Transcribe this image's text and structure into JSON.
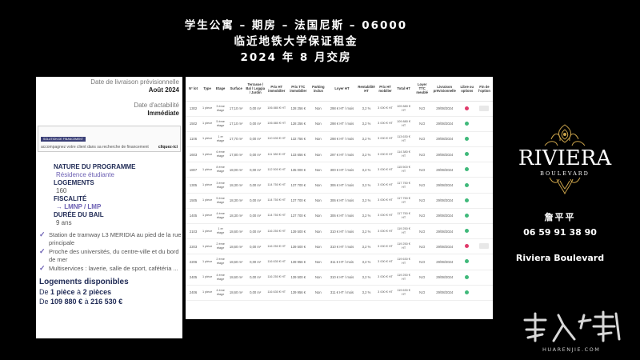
{
  "title": {
    "line1": "学生公寓 – 期房 – 法国尼斯 – 06000",
    "line2": "临近地铁大学保证租金",
    "line3": "2024 年 8 月交房"
  },
  "panel": {
    "delivery_label": "Date de livraison prévisionnelle",
    "delivery_value": "Août 2024",
    "actability_label": "Date d'actabilité",
    "actability_value": "Immédiate",
    "financing_tag": "SOLUTION DE FINANCEMENT",
    "financing_text": "accompagnez votre client dans sa recherche de financement",
    "financing_link": "cliquez-ici",
    "program_heading": "NATURE DU PROGRAMME",
    "program_value": "Résidence étudiante",
    "logements_heading": "LOGEMENTS",
    "logements_value": "160",
    "fiscalite_heading": "FISCALITÉ",
    "fiscalite_value": "→ LMNP / LMP",
    "bail_heading": "DURÉE DU BAIL",
    "bail_value": "9 ans",
    "checks": [
      "Station de tramway L3 MERIDIA au pied de la rue principale",
      "Proche des universités, du centre-ville et du bord de mer",
      "Multiservices : laverie, salle de sport, cafétéria ..."
    ],
    "avail_heading": "Logements disponibles",
    "avail_rooms_pre": "De ",
    "avail_rooms_from": "1 pièce",
    "avail_rooms_mid": " à ",
    "avail_rooms_to": "2 pièces",
    "avail_price_pre": "De ",
    "avail_price_from": "109 880 €",
    "avail_price_mid": " à ",
    "avail_price_to": "216 530 €"
  },
  "table": {
    "headers": [
      "N° lot",
      "Type",
      "Etage",
      "Surface",
      "Terrasse / Bal / Loggia / Jardin",
      "Prix HT immobilier",
      "Prix TTC immobilier",
      "Parking inclus",
      "Loyer HT",
      "Rentabilité HT",
      "Prix HT mobilier",
      "Total HT",
      "Loyer TTC meublé",
      "Livraison prévisionnelle",
      "Libre ou options",
      "Fin de l'option"
    ],
    "rows": [
      {
        "lot": "1302",
        "type": "1 pièce",
        "etage": "3 ème étage",
        "surface": "17,10 m²",
        "terrasse": "0,00 m²",
        "prix_ht": "106 880 € HT",
        "prix_ttc": "128 256 €",
        "parking": "Non",
        "loyer": "298 € HT / mois",
        "renta": "3,2 %",
        "mobilier": "3 000 € HT",
        "total": "109 880 € HT",
        "loyer_ttc": "N.D",
        "livraison": "29/08/2024",
        "status": "r",
        "fin": "thumb"
      },
      {
        "lot": "1502",
        "type": "1 pièce",
        "etage": "5 ème étage",
        "surface": "17,10 m²",
        "terrasse": "0,00 m²",
        "prix_ht": "106 880 € HT",
        "prix_ttc": "128 256 €",
        "parking": "Non",
        "loyer": "298 € HT / mois",
        "renta": "3,2 %",
        "mobilier": "3 000 € HT",
        "total": "109 880 € HT",
        "loyer_ttc": "N.D",
        "livraison": "29/08/2024",
        "status": "g",
        "fin": ""
      },
      {
        "lot": "1106",
        "type": "1 pièce",
        "etage": "1 er étage",
        "surface": "17,70 m²",
        "terrasse": "0,00 m²",
        "prix_ht": "110 630 € HT",
        "prix_ttc": "132 756 €",
        "parking": "Non",
        "loyer": "298 € HT / mois",
        "renta": "3,2 %",
        "mobilier": "3 000 € HT",
        "total": "113 630 € HT",
        "loyer_ttc": "N.D",
        "livraison": "29/08/2024",
        "status": "g",
        "fin": ""
      },
      {
        "lot": "1603",
        "type": "1 pièce",
        "etage": "6 ème étage",
        "surface": "17,80 m²",
        "terrasse": "0,00 m²",
        "prix_ht": "111 380 € HT",
        "prix_ttc": "133 656 €",
        "parking": "Non",
        "loyer": "297 € HT / mois",
        "renta": "3,2 %",
        "mobilier": "3 000 € HT",
        "total": "114 380 € HT",
        "loyer_ttc": "N.D",
        "livraison": "29/08/2024",
        "status": "g",
        "fin": ""
      },
      {
        "lot": "1807",
        "type": "1 pièce",
        "etage": "8 ème étage",
        "surface": "18,00 m²",
        "terrasse": "0,00 m²",
        "prix_ht": "112 500 € HT",
        "prix_ttc": "135 000 €",
        "parking": "Non",
        "loyer": "300 € HT / mois",
        "renta": "3,2 %",
        "mobilier": "3 000 € HT",
        "total": "115 500 € HT",
        "loyer_ttc": "N.D",
        "livraison": "29/08/2024",
        "status": "g",
        "fin": ""
      },
      {
        "lot": "1305",
        "type": "1 pièce",
        "etage": "3 ème étage",
        "surface": "18,30 m²",
        "terrasse": "0,00 m²",
        "prix_ht": "114 750 € HT",
        "prix_ttc": "137 700 €",
        "parking": "Non",
        "loyer": "306 € HT / mois",
        "renta": "3,2 %",
        "mobilier": "3 000 € HT",
        "total": "117 750 € HT",
        "loyer_ttc": "N.D",
        "livraison": "29/08/2024",
        "status": "g",
        "fin": ""
      },
      {
        "lot": "1505",
        "type": "1 pièce",
        "etage": "5 ème étage",
        "surface": "18,30 m²",
        "terrasse": "0,00 m²",
        "prix_ht": "114 750 € HT",
        "prix_ttc": "137 700 €",
        "parking": "Non",
        "loyer": "306 € HT / mois",
        "renta": "3,2 %",
        "mobilier": "3 000 € HT",
        "total": "117 750 € HT",
        "loyer_ttc": "N.D",
        "livraison": "29/08/2024",
        "status": "g",
        "fin": ""
      },
      {
        "lot": "1405",
        "type": "1 pièce",
        "etage": "4 ème étage",
        "surface": "18,30 m²",
        "terrasse": "0,00 m²",
        "prix_ht": "114 750 € HT",
        "prix_ttc": "137 700 €",
        "parking": "Non",
        "loyer": "306 € HT / mois",
        "renta": "3,2 %",
        "mobilier": "3 000 € HT",
        "total": "117 750 € HT",
        "loyer_ttc": "N.D",
        "livraison": "29/08/2024",
        "status": "g",
        "fin": ""
      },
      {
        "lot": "2103",
        "type": "1 pièce",
        "etage": "1 er étage",
        "surface": "18,60 m²",
        "terrasse": "0,00 m²",
        "prix_ht": "116 250 € HT",
        "prix_ttc": "139 500 €",
        "parking": "Non",
        "loyer": "310 € HT / mois",
        "renta": "3,2 %",
        "mobilier": "3 000 € HT",
        "total": "119 250 € HT",
        "loyer_ttc": "N.D",
        "livraison": "29/08/2024",
        "status": "g",
        "fin": ""
      },
      {
        "lot": "2203",
        "type": "1 pièce",
        "etage": "2 ème étage",
        "surface": "18,60 m²",
        "terrasse": "0,00 m²",
        "prix_ht": "116 250 € HT",
        "prix_ttc": "139 500 €",
        "parking": "Non",
        "loyer": "310 € HT / mois",
        "renta": "3,2 %",
        "mobilier": "3 000 € HT",
        "total": "119 250 € HT",
        "loyer_ttc": "N.D",
        "livraison": "29/08/2024",
        "status": "r",
        "fin": "thumb"
      },
      {
        "lot": "2206",
        "type": "1 pièce",
        "etage": "2 ème étage",
        "surface": "18,60 m²",
        "terrasse": "0,00 m²",
        "prix_ht": "116 630 € HT",
        "prix_ttc": "139 956 €",
        "parking": "Non",
        "loyer": "311 € HT / mois",
        "renta": "3,2 %",
        "mobilier": "3 000 € HT",
        "total": "119 630 € HT",
        "loyer_ttc": "N.D",
        "livraison": "29/08/2024",
        "status": "g",
        "fin": ""
      },
      {
        "lot": "2405",
        "type": "1 pièce",
        "etage": "4 ème étage",
        "surface": "18,60 m²",
        "terrasse": "0,00 m²",
        "prix_ht": "116 250 € HT",
        "prix_ttc": "139 500 €",
        "parking": "Non",
        "loyer": "310 € HT / mois",
        "renta": "3,2 %",
        "mobilier": "3 000 € HT",
        "total": "119 250 € HT",
        "loyer_ttc": "N.D",
        "livraison": "29/08/2024",
        "status": "g",
        "fin": ""
      },
      {
        "lot": "2406",
        "type": "1 pièce",
        "etage": "4 ème étage",
        "surface": "18,60 m²",
        "terrasse": "0,00 m²",
        "prix_ht": "116 630 € HT",
        "prix_ttc": "139 956 €",
        "parking": "Non",
        "loyer": "311 € HT / mois",
        "renta": "3,2 %",
        "mobilier": "3 000 € HT",
        "total": "119 630 € HT",
        "loyer_ttc": "N.D",
        "livraison": "29/08/2024",
        "status": "g",
        "fin": ""
      }
    ]
  },
  "brand": {
    "name": "RIVIERA",
    "sub": "BOULEVARD",
    "gold": "#c9a24a"
  },
  "contact": {
    "name": "詹平平",
    "phone": "06 59 91 38 90",
    "business": "Riviera Boulevard"
  },
  "watermark": {
    "chars": "華人街",
    "latin": "HUARENJIE.COM"
  },
  "colors": {
    "green": "#3fb97a",
    "red": "#e03a6a",
    "purple": "#6b5fb3",
    "navy": "#1f2a55"
  }
}
